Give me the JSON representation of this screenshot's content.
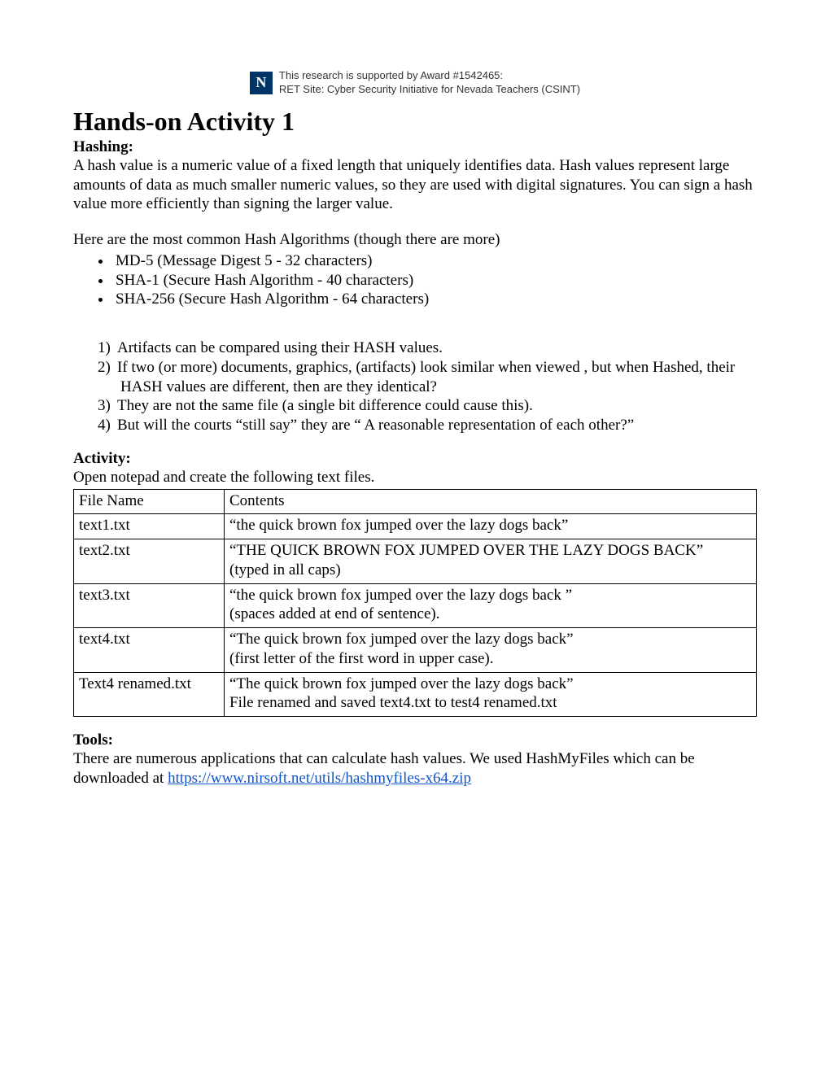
{
  "banner": {
    "line1": "This research is supported by Award #1542465:",
    "line2": "RET Site: Cyber Security Initiative for Nevada Teachers (CSINT)"
  },
  "title": "Hands-on Activity 1",
  "hashing": {
    "heading": "Hashing:",
    "para": "A hash value is a numeric value of a fixed length that uniquely identifies data. Hash values represent large amounts of data as much smaller numeric values, so they are used with digital signatures. You can sign a hash value more efficiently than signing the larger value.",
    "algos_intro": "Here are the most common Hash Algorithms (though there are more)",
    "algos": [
      "MD-5 (Message Digest 5 - 32 characters)",
      "SHA-1 (Secure Hash Algorithm - 40 characters)",
      "SHA-256 (Secure Hash Algorithm - 64 characters)"
    ],
    "notes": [
      "Artifacts can be compared using their HASH values.",
      "If two (or more) documents, graphics, (artifacts) look similar when viewed , but when Hashed, their HASH values are different, then are they identical?",
      "They are not the same file (a single bit difference could cause this).",
      "But will the courts “still say” they are “ A reasonable representation of each other?”"
    ]
  },
  "activity": {
    "heading": "Activity:",
    "intro": "Open notepad and create the following text files.",
    "headers": {
      "col1": "File Name",
      "col2": "Contents"
    },
    "rows": [
      {
        "file": "text1.txt",
        "line1": "“the quick brown fox jumped over the lazy dogs back”",
        "line2": "",
        "tall": "row-tall"
      },
      {
        "file": "text2.txt",
        "line1": "“THE QUICK BROWN FOX JUMPED OVER THE LAZY DOGS BACK”",
        "line2": "(typed in all caps)",
        "tall": "row-med"
      },
      {
        "file": "text3.txt",
        "line1": "“the quick brown fox jumped over the lazy dogs back ”",
        "line2": "(spaces added at end of sentence).",
        "tall": ""
      },
      {
        "file": "text4.txt",
        "line1": "“The quick brown fox jumped over the lazy dogs back”",
        "line2": "(first letter of the first word in upper case).",
        "tall": ""
      },
      {
        "file": "Text4 renamed.txt",
        "line1": "“The quick brown fox jumped over the lazy dogs back”",
        "line2": "File renamed and saved text4.txt to test4 renamed.txt",
        "tall": ""
      }
    ]
  },
  "tools": {
    "heading": "Tools:",
    "text_before_link": "There are numerous applications that can calculate hash values. We used HashMyFiles which can be downloaded at ",
    "link_text": "https://www.nirsoft.net/utils/hashmyfiles-x64.zip"
  }
}
